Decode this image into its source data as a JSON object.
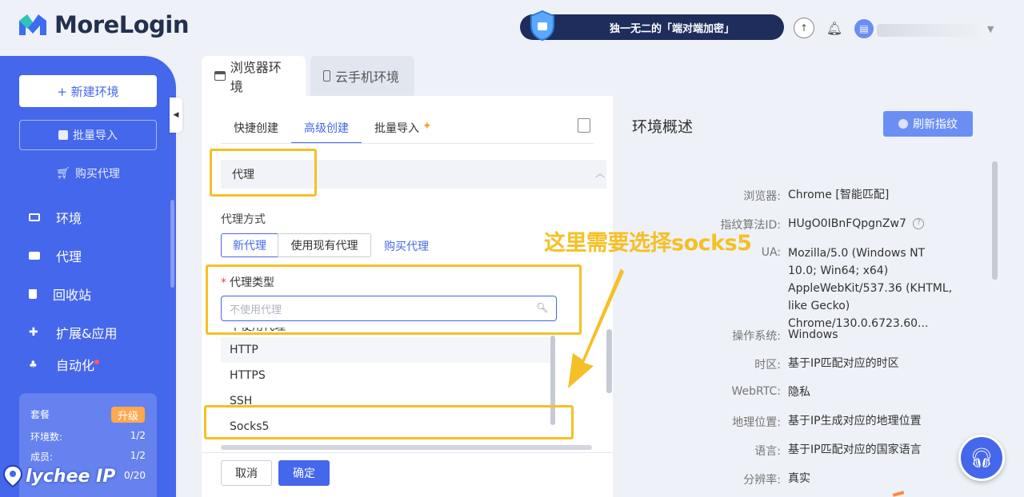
{
  "app": {
    "name": "MoreLogin"
  },
  "header": {
    "promo_text": "独一无二的「端对端加密」",
    "icons": [
      "upload-icon",
      "bell-icon",
      "avatar-icon",
      "chevron-down-icon"
    ]
  },
  "sidebar": {
    "new_env": "+ 新建环境",
    "batch_import": "批量导入",
    "buy_proxy": "购买代理",
    "items": [
      {
        "label": "环境",
        "icon": "monitor-icon"
      },
      {
        "label": "代理",
        "icon": "server-icon"
      },
      {
        "label": "回收站",
        "icon": "trash-icon"
      },
      {
        "label": "扩展&应用",
        "icon": "puzzle-icon"
      },
      {
        "label": "自动化",
        "icon": "automation-icon"
      }
    ],
    "plan": {
      "title": "套餐",
      "upgrade": "升级",
      "rows": [
        {
          "label": "环境数:",
          "value": "1/2"
        },
        {
          "label": "成员:",
          "value": "1/2"
        },
        {
          "label": "",
          "value": "0/20"
        }
      ]
    }
  },
  "watermark": {
    "text": "lychee IP"
  },
  "main_tabs": [
    {
      "label": "浏览器环境",
      "icon": "browser-icon",
      "active": true
    },
    {
      "label": "云手机环境",
      "icon": "phone-icon",
      "active": false
    }
  ],
  "form": {
    "sub_tabs": [
      {
        "label": "快捷创建"
      },
      {
        "label": "高级创建",
        "active": true
      },
      {
        "label": "批量导入",
        "badge": "sparkle-icon"
      }
    ],
    "section_title": "代理",
    "proxy_mode_label": "代理方式",
    "proxy_modes": [
      "新代理",
      "使用现有代理"
    ],
    "buy_proxy_link": "购买代理",
    "proxy_type_label": "代理类型",
    "proxy_type_placeholder": "不使用代理",
    "dropdown_partial": "不使用代理",
    "dropdown_options": [
      "HTTP",
      "HTTPS",
      "SSH",
      "Socks5"
    ],
    "cancel": "取消",
    "ok": "确定"
  },
  "overview": {
    "title": "环境概述",
    "refresh": "刷新指纹",
    "rows": [
      {
        "label": "浏览器:",
        "value": "Chrome [智能匹配]"
      },
      {
        "label": "指纹算法ID:",
        "value": "HUgO0IBnFQpgnZw7"
      },
      {
        "label": "UA:",
        "value": "Mozilla/5.0 (Windows NT 10.0; Win64; x64) AppleWebKit/537.36 (KHTML, like Gecko) Chrome/130.0.6723.60..."
      },
      {
        "label": "操作系统:",
        "value": "Windows"
      },
      {
        "label": "时区:",
        "value": "基于IP匹配对应的时区"
      },
      {
        "label": "WebRTC:",
        "value": "隐私"
      },
      {
        "label": "地理位置:",
        "value": "基于IP生成对应的地理位置"
      },
      {
        "label": "语言:",
        "value": "基于IP匹配对应的国家语言"
      },
      {
        "label": "分辨率:",
        "value": "真实"
      }
    ]
  },
  "annotation": {
    "callout": "这里需要选择socks5",
    "color": "#f5c027"
  },
  "colors": {
    "primary": "#4567eb",
    "sidebar": "#4567eb",
    "accent_orange": "#ffa94d"
  }
}
